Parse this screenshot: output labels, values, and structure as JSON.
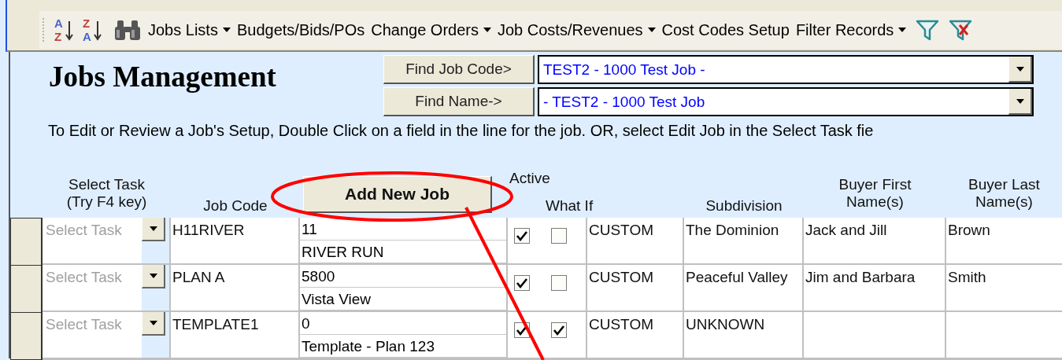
{
  "toolbar": {
    "sort_buttons": [
      {
        "top": "A",
        "bottom": "Z"
      },
      {
        "top": "Z",
        "bottom": "A"
      }
    ],
    "menus": [
      {
        "label": "Jobs Lists",
        "dropdown": true
      },
      {
        "label": "Budgets/Bids/POs",
        "dropdown": false
      },
      {
        "label": "Change Orders",
        "dropdown": true
      },
      {
        "label": "Job Costs/Revenues",
        "dropdown": true
      },
      {
        "label": "Cost Codes Setup",
        "dropdown": false
      },
      {
        "label": "Filter Records",
        "dropdown": true
      }
    ]
  },
  "form": {
    "title": "Jobs Management",
    "finders": [
      {
        "button": "Find Job Code>",
        "value": "TEST2 - 1000 Test Job -"
      },
      {
        "button": "Find Name->",
        "value": "- TEST2 - 1000 Test Job"
      }
    ],
    "instructions": "To Edit or Review a Job's Setup, Double Click on a field in the line for the job.  OR, select Edit Job in the Select Task fie"
  },
  "table": {
    "add_button": "Add New Job",
    "columns": [
      {
        "label": "Select Task\n(Try F4 key)"
      },
      {
        "label": "Job Code"
      },
      {
        "label": "Active"
      },
      {
        "label": "What If"
      },
      {
        "label": "Subdivision"
      },
      {
        "label": "Buyer First\nName(s)"
      },
      {
        "label": "Buyer Last\nName(s)"
      }
    ],
    "rows": [
      {
        "task_placeholder": "Select Task",
        "job_code": "H11RIVER",
        "number": "11",
        "name": "RIVER RUN",
        "active": true,
        "what_if": false,
        "type": "CUSTOM",
        "subdivision": "The Dominion",
        "buyer_first": "Jack and Jill",
        "buyer_last": "Brown"
      },
      {
        "task_placeholder": "Select Task",
        "job_code": "PLAN A",
        "number": "5800",
        "name": "Vista View",
        "active": true,
        "what_if": false,
        "type": "CUSTOM",
        "subdivision": "Peaceful Valley",
        "buyer_first": "Jim and Barbara",
        "buyer_last": "Smith"
      },
      {
        "task_placeholder": "Select Task",
        "job_code": "TEMPLATE1",
        "number": "0",
        "name": "Template - Plan 123",
        "active": true,
        "what_if": true,
        "type": "CUSTOM",
        "subdivision": "UNKNOWN"
      }
    ]
  }
}
